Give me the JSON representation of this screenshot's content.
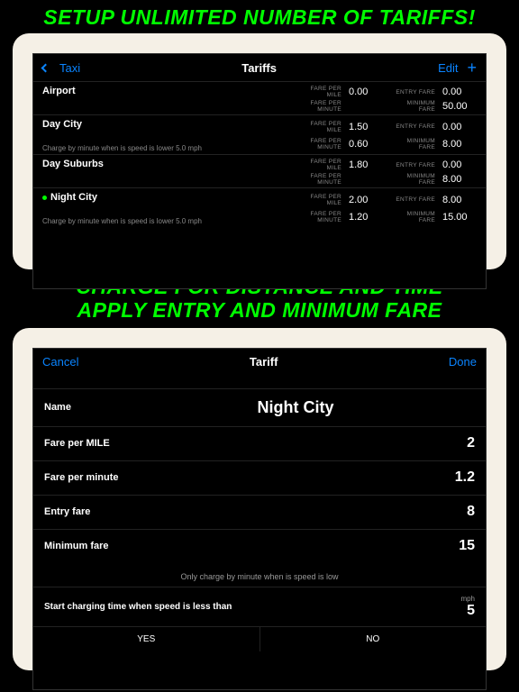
{
  "promo1": "SETUP UNLIMITED NUMBER OF TARIFFS!",
  "promo2a": "CHARGE FOR DISTANCE AND TIME",
  "promo2b": "APPLY ENTRY AND MINIMUM FARE",
  "screen1": {
    "back": "Taxi",
    "title": "Tariffs",
    "edit": "Edit",
    "labels": {
      "fpm": "FARE PER MILE",
      "fpmin": "FARE PER MINUTE",
      "ef": "ENTRY FARE",
      "mf": "MINIMUM FARE"
    },
    "rows": [
      {
        "name": "Airport",
        "active": false,
        "fpm": "0.00",
        "fpmin": "",
        "ef": "0.00",
        "mf": "50.00",
        "note": ""
      },
      {
        "name": "Day City",
        "active": false,
        "fpm": "1.50",
        "fpmin": "0.60",
        "ef": "0.00",
        "mf": "8.00",
        "note": "Charge by minute when is speed is lower 5.0  mph"
      },
      {
        "name": "Day Suburbs",
        "active": false,
        "fpm": "1.80",
        "fpmin": "",
        "ef": "0.00",
        "mf": "8.00",
        "note": ""
      },
      {
        "name": "Night City",
        "active": true,
        "fpm": "2.00",
        "fpmin": "1.20",
        "ef": "8.00",
        "mf": "15.00",
        "note": "Charge by minute when is speed is lower 5.0  mph"
      }
    ]
  },
  "screen2": {
    "cancel": "Cancel",
    "title": "Tariff",
    "done": "Done",
    "name_label": "Name",
    "name_value": "Night City",
    "fields": [
      {
        "label": "Fare per MILE",
        "value": "2"
      },
      {
        "label": "Fare per minute",
        "value": "1.2"
      },
      {
        "label": "Entry fare",
        "value": "8"
      },
      {
        "label": "Minimum fare",
        "value": "15"
      }
    ],
    "info": "Only charge by minute when is speed is low",
    "speed_label": "Start charging time when speed is less than",
    "speed_unit": "mph",
    "speed_value": "5",
    "yes": "YES",
    "no": "NO"
  }
}
